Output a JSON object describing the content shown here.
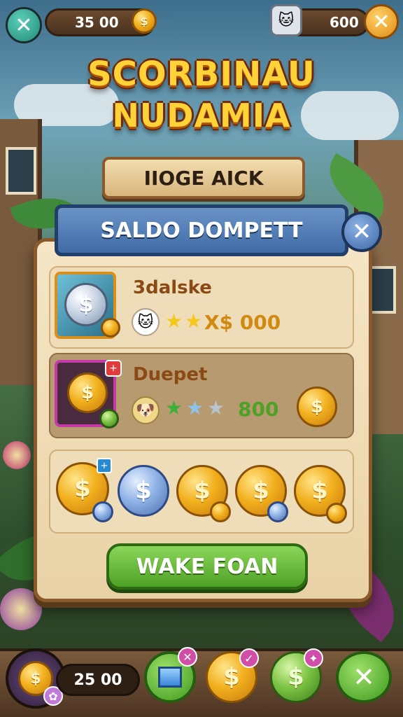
{
  "top_bar": {
    "left_currency_value": "35 00",
    "right_currency_value": "600"
  },
  "title": {
    "line1": "SCORBINAU",
    "line2": "NUDAMIA"
  },
  "sign": {
    "text": "IIOGE AICK"
  },
  "panel": {
    "header": "SALDO DOMPETT",
    "rows": [
      {
        "name": "3dalske",
        "value": "X$ 000",
        "stars_filled": 2,
        "stars_total": 2
      },
      {
        "name": "Duepet",
        "value": "800",
        "stars_filled": 1,
        "stars_total": 3
      }
    ],
    "coins_row": [
      "$",
      "$",
      "$",
      "$",
      "$"
    ],
    "action_button": "WAKE FOAN"
  },
  "bottom_bar": {
    "balance": "25 00"
  },
  "colors": {
    "accent_gold": "#f2b01e",
    "banner_blue": "#3f6aa4",
    "button_green": "#4ea126"
  }
}
